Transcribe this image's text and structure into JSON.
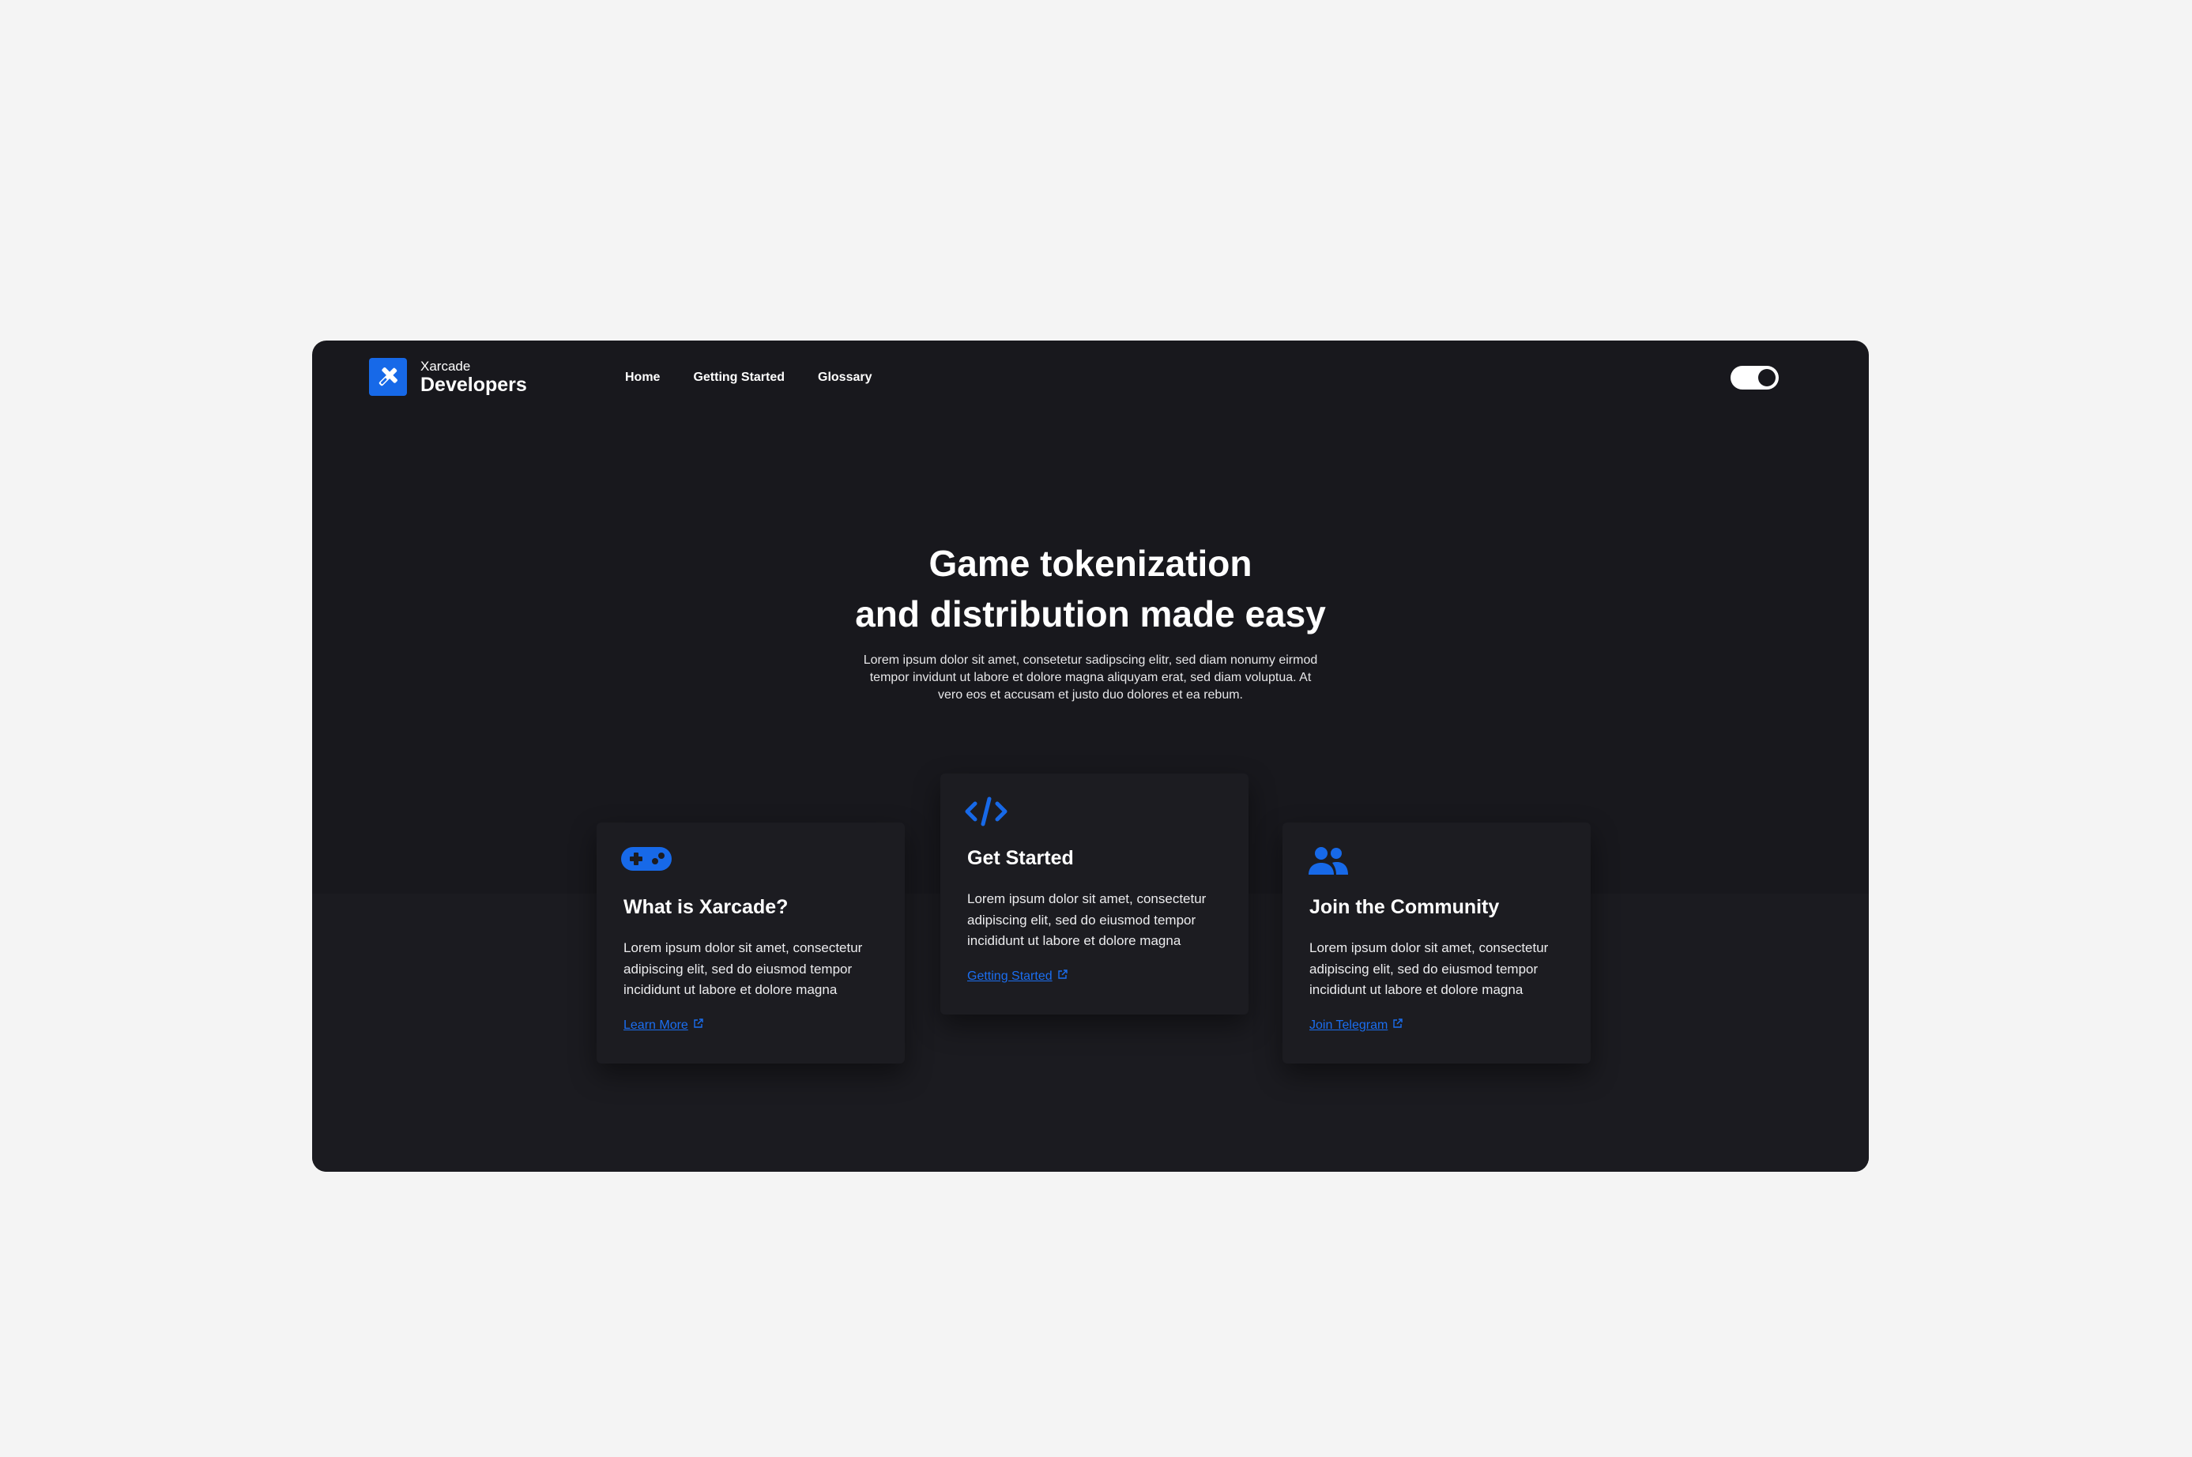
{
  "app": {
    "logo_small": "Xarcade",
    "logo_big": "Developers"
  },
  "nav": {
    "items": [
      {
        "label": "Home"
      },
      {
        "label": "Getting Started"
      },
      {
        "label": "Glossary"
      }
    ]
  },
  "theme_toggle": {
    "state": "on"
  },
  "hero": {
    "title_line1": "Game tokenization",
    "title_line2": "and distribution made easy",
    "body": "Lorem ipsum dolor sit amet, consetetur sadipscing elitr, sed diam nonumy eirmod tempor invidunt ut labore et dolore magna aliquyam erat, sed diam voluptua. At vero eos et accusam et justo duo dolores et ea rebum."
  },
  "cards": [
    {
      "icon": "gamepad-icon",
      "title": "What is Xarcade?",
      "body": "Lorem ipsum dolor sit amet, consectetur adipiscing elit, sed do eiusmod tempor incididunt ut labore et dolore magna",
      "link": "Learn More"
    },
    {
      "icon": "code-icon",
      "title": "Get Started",
      "body": "Lorem ipsum dolor sit amet, consectetur adipiscing elit, sed do eiusmod tempor incididunt ut labore et dolore magna",
      "link": "Getting Started"
    },
    {
      "icon": "users-icon",
      "title": "Join the Community",
      "body": "Lorem ipsum dolor sit amet, consectetur adipiscing elit, sed do eiusmod tempor incididunt ut labore et dolore magna",
      "link": "Join Telegram"
    }
  ],
  "colors": {
    "accent": "#1769e8",
    "window_bg": "#18181d",
    "page_bg": "#f4f4f4"
  }
}
